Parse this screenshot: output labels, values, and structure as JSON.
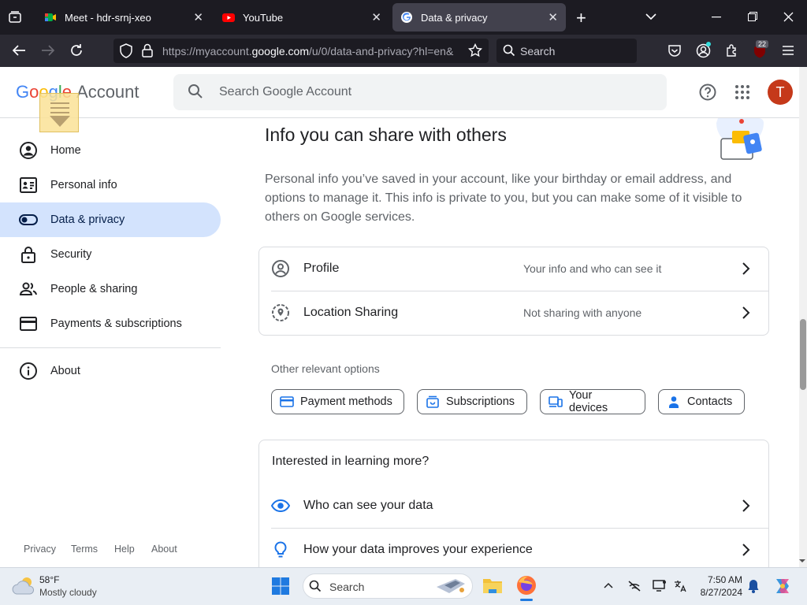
{
  "browser": {
    "tabs": [
      {
        "title": "Meet - hdr-srnj-xeo"
      },
      {
        "title": "YouTube"
      },
      {
        "title": "Data & privacy"
      }
    ],
    "new_tab_label": "+",
    "url_prefix": "https://myaccount.",
    "url_domain": "google.com",
    "url_suffix": "/u/0/data-and-privacy?hl=en&",
    "search_placeholder": "Search",
    "extension_badge": "22"
  },
  "header": {
    "logo_google": "Google",
    "logo_account": "Account",
    "search_placeholder": "Search Google Account",
    "avatar_initial": "T"
  },
  "sidebar": {
    "items": [
      {
        "label": "Home"
      },
      {
        "label": "Personal info"
      },
      {
        "label": "Data & privacy"
      },
      {
        "label": "Security"
      },
      {
        "label": "People & sharing"
      },
      {
        "label": "Payments & subscriptions"
      },
      {
        "label": "About"
      }
    ],
    "footer": [
      "Privacy",
      "Terms",
      "Help",
      "About"
    ]
  },
  "main": {
    "section_title": "Info you can share with others",
    "section_desc": "Personal info you’ve saved in your account, like your birthday or email address, and options to manage it. This info is private to you, but you can make some of it visible to others on Google services.",
    "rows": [
      {
        "label": "Profile",
        "desc": "Your info and who can see it"
      },
      {
        "label": "Location Sharing",
        "desc": "Not sharing with anyone"
      }
    ],
    "other_options_label": "Other relevant options",
    "chips": [
      "Payment methods",
      "Subscriptions",
      "Your devices",
      "Contacts"
    ],
    "learn_title": "Interested in learning more?",
    "learn_rows": [
      {
        "label": "Who can see your data"
      },
      {
        "label": "How your data improves your experience"
      }
    ]
  },
  "taskbar": {
    "weather_temp": "58°F",
    "weather_desc": "Mostly cloudy",
    "search_placeholder": "Search",
    "time": "7:50 AM",
    "date": "8/27/2024"
  },
  "colors": {
    "google_blue": "#4285F4",
    "google_red": "#EA4335",
    "google_yellow": "#FBBC05",
    "google_green": "#34A853",
    "active_nav_bg": "#d3e3fd",
    "avatar_bg": "#c5391a",
    "icon_blue": "#1a73e8"
  }
}
